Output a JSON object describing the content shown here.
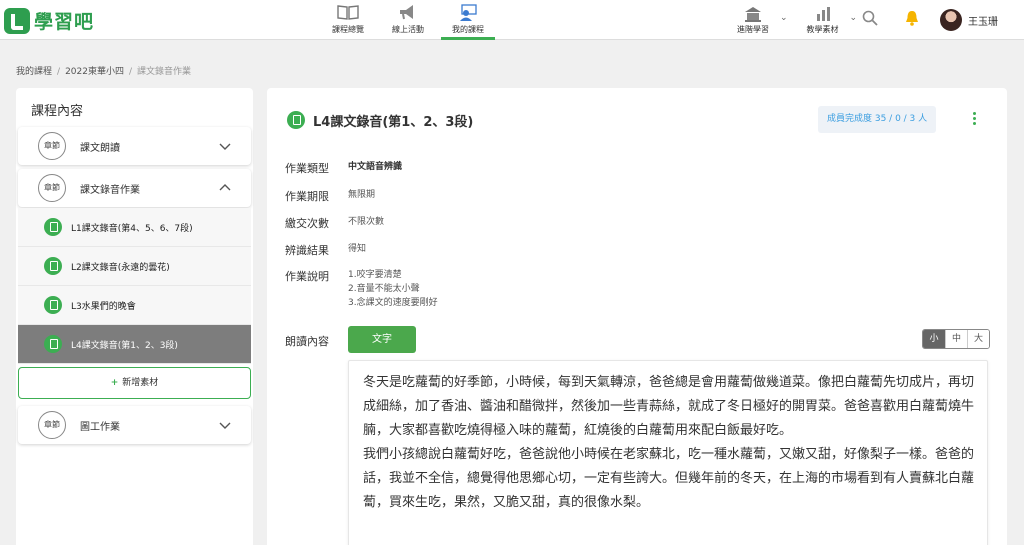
{
  "header": {
    "logo_text": "學習吧",
    "nav": [
      {
        "label": "課程總覽",
        "icon": "book-icon"
      },
      {
        "label": "線上活動",
        "icon": "megaphone-icon"
      },
      {
        "label": "我的課程",
        "icon": "teacher-icon"
      }
    ],
    "right_nav": [
      {
        "label": "進階學習",
        "icon": "building-icon"
      },
      {
        "label": "教學素材",
        "icon": "bar-chart-icon"
      }
    ],
    "user_name": "王玉珊",
    "colors": {
      "brand": "#2e9e4f",
      "accent": "#3cae52",
      "bell": "#f5b400"
    }
  },
  "breadcrumb": {
    "items": [
      "我的課程",
      "2022東華小四"
    ],
    "separator": "/",
    "current": "課文錄音作業"
  },
  "sidebar": {
    "title": "課程內容",
    "chapter_badge": "章節",
    "chapters": [
      {
        "label": "課文朗讀",
        "expanded": false
      },
      {
        "label": "課文錄音作業",
        "expanded": true
      },
      {
        "label": "圖工作業",
        "expanded": false
      }
    ],
    "items": [
      {
        "label": "L1課文錄音(第4、5、6、7段)"
      },
      {
        "label": "L2課文錄音(永遠的曇花)"
      },
      {
        "label": "L3水果們的晚會"
      },
      {
        "label": "L4課文錄音(第1、2、3段)",
        "active": true
      }
    ],
    "add_material": {
      "plus": "+",
      "label": "新增素材"
    }
  },
  "main": {
    "title": "L4課文錄音(第1、2、3段)",
    "progress": "成員完成度 35 / 0 / 3 人",
    "fields": [
      {
        "label": "作業類型",
        "value": "中文語音辨識"
      },
      {
        "label": "作業期限",
        "value": "無限期"
      },
      {
        "label": "繳交次數",
        "value": "不限次數"
      },
      {
        "label": "辨識結果",
        "value": "得知"
      }
    ],
    "description": {
      "label": "作業說明",
      "lines": [
        "1.咬字要清楚",
        "2.音量不能太小聲",
        "3.念課文的速度要剛好"
      ]
    },
    "reading": {
      "label": "朗讀內容",
      "text_button": "文字",
      "size_options": [
        "小",
        "中",
        "大"
      ],
      "selected_size": "小",
      "paragraphs": [
        "冬天是吃蘿蔔的好季節，小時候，每到天氣轉涼，爸爸總是會用蘿蔔做幾道菜。像把白蘿蔔先切成片，再切成細絲，加了香油、醬油和醋微拌，然後加一些青蒜絲，就成了冬日極好的開胃菜。爸爸喜歡用白蘿蔔燒牛腩，大家都喜歡吃燒得極入味的蘿蔔，紅燒後的白蘿蔔用來配白飯最好吃。",
        "我們小孩總說白蘿蔔好吃，爸爸說他小時候在老家蘇北，吃一種水蘿蔔，又嫩又甜，好像梨子一樣。爸爸的話，我並不全信，總覺得他思鄉心切，一定有些誇大。但幾年前的冬天，在上海的市場看到有人賣蘇北白蘿蔔，買來生吃，果然，又脆又甜，真的很像水梨。"
      ]
    }
  }
}
